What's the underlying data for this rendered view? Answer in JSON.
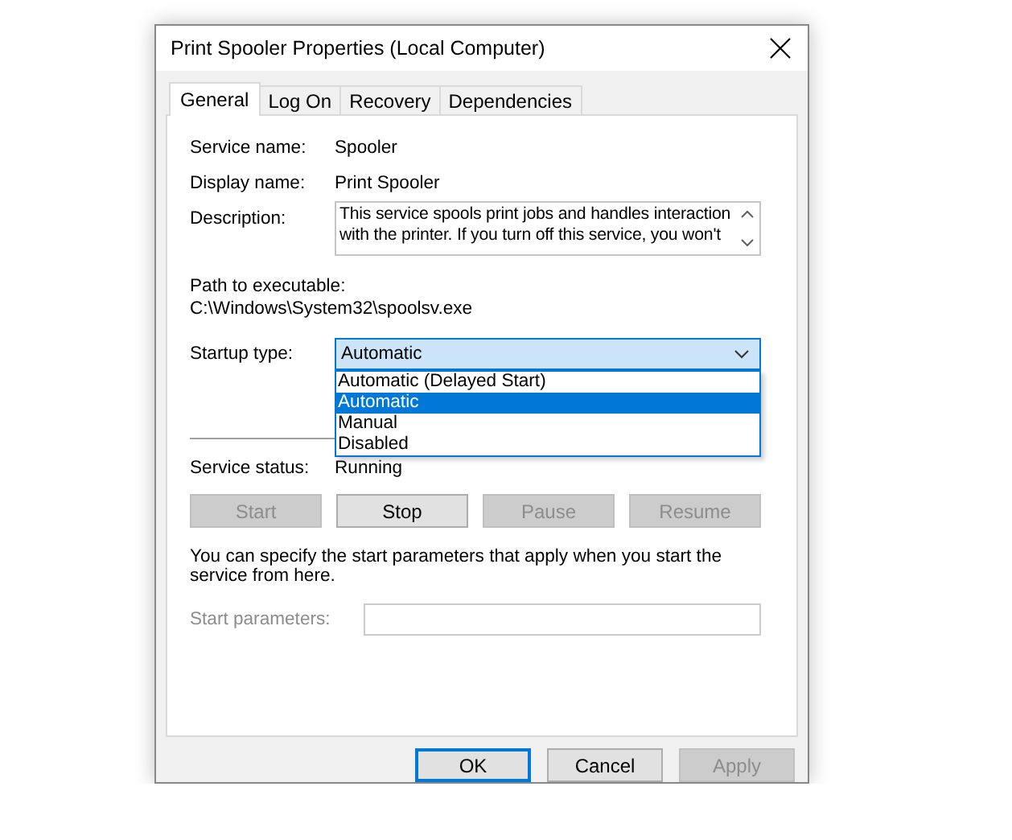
{
  "window": {
    "title": "Print Spooler Properties (Local Computer)"
  },
  "tabs": [
    {
      "label": "General",
      "selected": true
    },
    {
      "label": "Log On",
      "selected": false
    },
    {
      "label": "Recovery",
      "selected": false
    },
    {
      "label": "Dependencies",
      "selected": false
    }
  ],
  "fields": [
    {
      "label": "Service name:",
      "value": "Spooler"
    },
    {
      "label": "Display name:",
      "value": "Print Spooler"
    }
  ],
  "description": {
    "label": "Description:",
    "value": "This service spools print jobs and handles interaction with the printer.  If you turn off this service, you won't"
  },
  "path": {
    "label": "Path to executable:",
    "value": "C:\\Windows\\System32\\spoolsv.exe"
  },
  "startup_type": {
    "label": "Startup type:",
    "value": "Automatic",
    "expanded": true,
    "options": [
      {
        "label": "Automatic (Delayed Start)",
        "selected": false
      },
      {
        "label": "Automatic",
        "selected": true
      },
      {
        "label": "Manual",
        "selected": false
      },
      {
        "label": "Disabled",
        "selected": false
      }
    ]
  },
  "service_status": {
    "label": "Service status:",
    "value": "Running"
  },
  "service_buttons": [
    {
      "label": "Start",
      "disabled": true
    },
    {
      "label": "Stop",
      "disabled": false
    },
    {
      "label": "Pause",
      "disabled": true
    },
    {
      "label": "Resume",
      "disabled": true
    }
  ],
  "hint": "You can specify the start parameters that apply when you start the service from here.",
  "start_parameters": {
    "label": "Start parameters:",
    "disabled": true
  },
  "dialog_buttons": [
    {
      "label": "OK",
      "default": true,
      "disabled": false
    },
    {
      "label": "Cancel",
      "default": false,
      "disabled": false
    },
    {
      "label": "Apply",
      "default": false,
      "disabled": true
    }
  ]
}
